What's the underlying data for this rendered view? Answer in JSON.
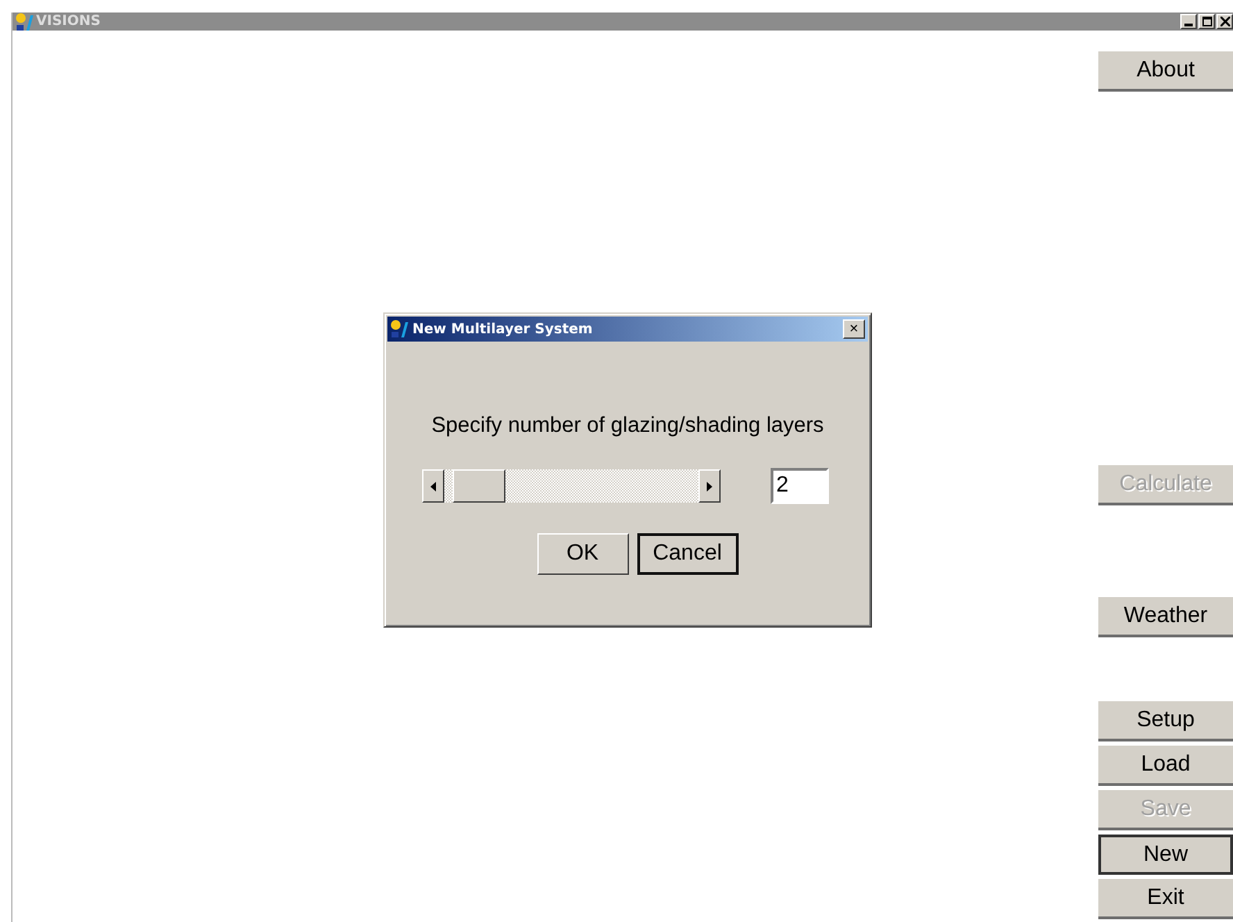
{
  "window": {
    "title": "VISIONS"
  },
  "sidebar": {
    "groups": [
      [
        {
          "label": "About",
          "disabled": false,
          "default": false
        }
      ],
      [
        {
          "label": "Calculate",
          "disabled": true,
          "default": false
        }
      ],
      [
        {
          "label": "Weather",
          "disabled": false,
          "default": false
        }
      ],
      [
        {
          "label": "Setup",
          "disabled": false,
          "default": false
        },
        {
          "label": "Load",
          "disabled": false,
          "default": false
        },
        {
          "label": "Save",
          "disabled": true,
          "default": false
        },
        {
          "label": "New",
          "disabled": false,
          "default": true
        },
        {
          "label": "Exit",
          "disabled": false,
          "default": false
        }
      ]
    ]
  },
  "dialog": {
    "title": "New Multilayer System",
    "close": "×",
    "prompt": "Specify number of glazing/shading layers",
    "value": "2",
    "buttons": [
      {
        "label": "OK",
        "default": false
      },
      {
        "label": "Cancel",
        "default": true
      }
    ]
  }
}
